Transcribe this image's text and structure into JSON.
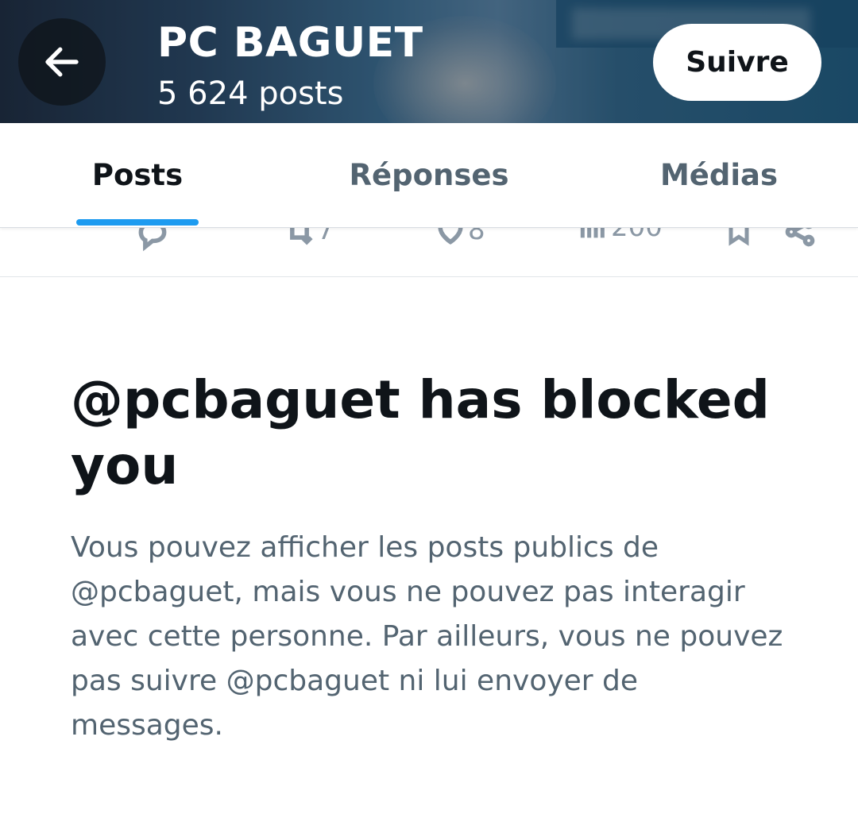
{
  "header": {
    "title": "PC BAGUET",
    "post_count": "5 624 posts",
    "follow_label": "Suivre",
    "back_icon": "arrow-left-icon"
  },
  "tabs": [
    {
      "label": "Posts",
      "active": true
    },
    {
      "label": "Réponses",
      "active": false
    },
    {
      "label": "Médias",
      "active": false
    }
  ],
  "post_actions": {
    "reposts": "7",
    "likes": "8",
    "views": "200"
  },
  "blocked": {
    "title": "@pcbaguet has blocked you",
    "description": "Vous pouvez afficher les posts publics de @pcbaguet, mais vous ne pouvez pas interagir avec cette personne. Par ailleurs, vous ne pouvez pas suivre @pcbaguet ni lui envoyer de messages."
  },
  "colors": {
    "accent": "#1d9bf0",
    "text_primary": "#0f1419",
    "text_secondary": "#536471"
  }
}
